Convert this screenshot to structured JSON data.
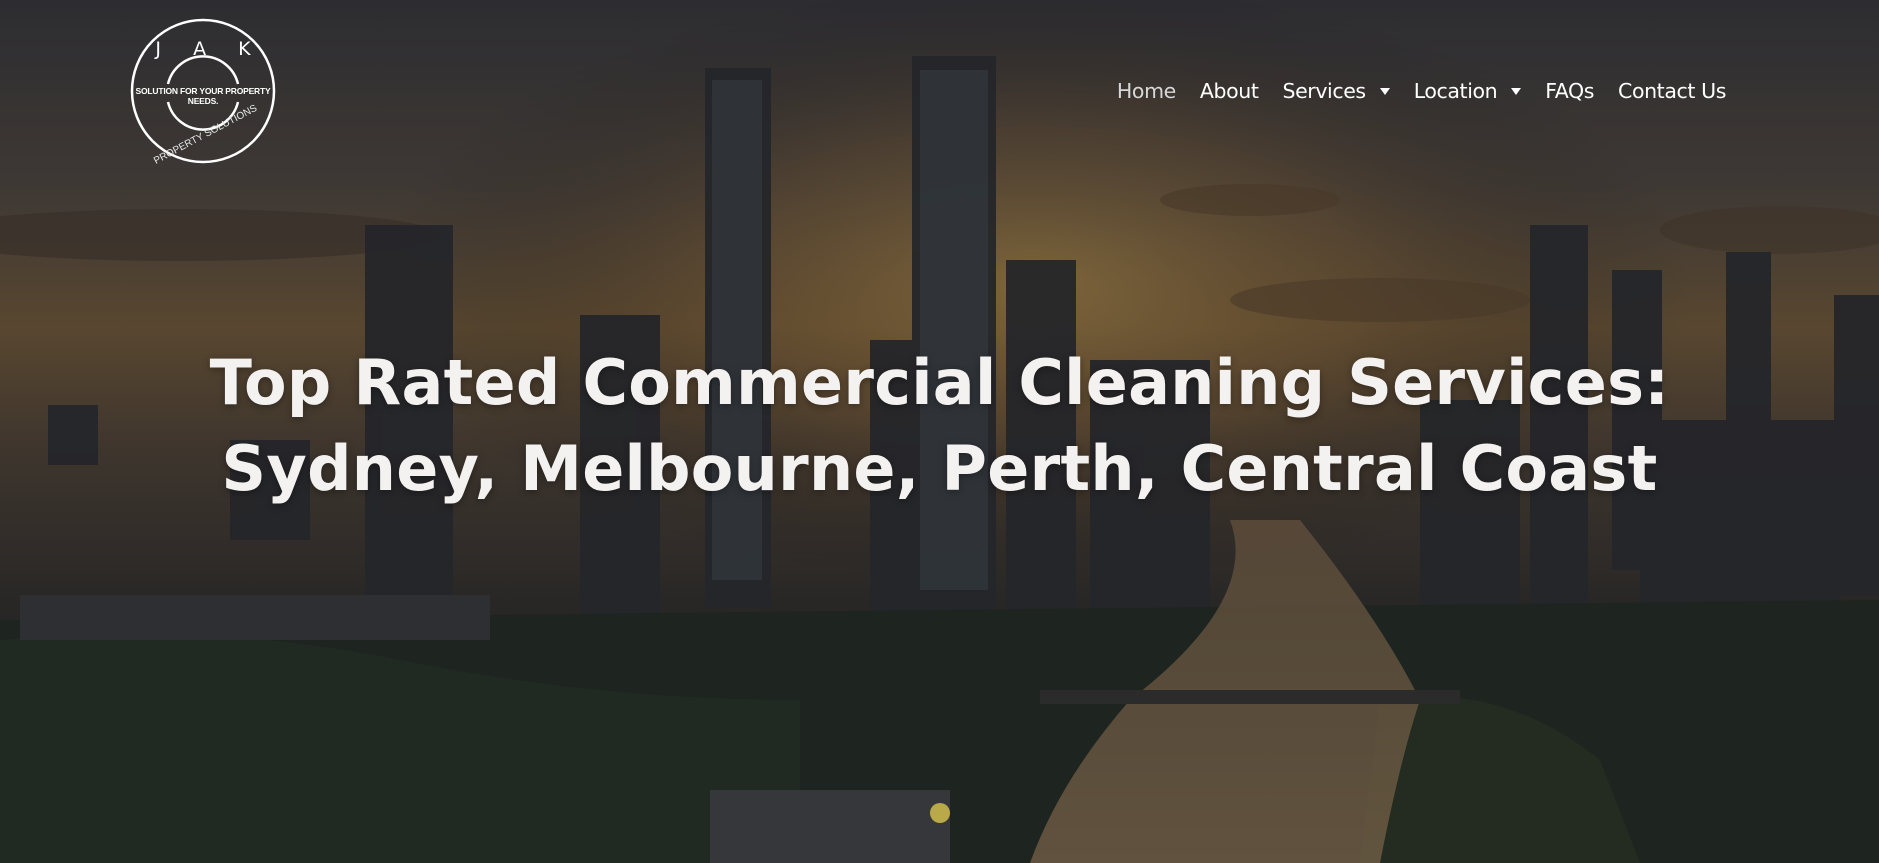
{
  "brand": {
    "letters": "J A K",
    "tagline": "SOLUTION FOR YOUR PROPERTY NEEDS.",
    "subtitle": "PROPERTY SOLUTIONS"
  },
  "nav": {
    "items": [
      {
        "label": "Home",
        "active": true
      },
      {
        "label": "About",
        "has_dropdown": false
      },
      {
        "label": "Services",
        "has_dropdown": true
      },
      {
        "label": "Location",
        "has_dropdown": true
      },
      {
        "label": "FAQs",
        "has_dropdown": false
      },
      {
        "label": "Contact Us",
        "has_dropdown": false
      }
    ]
  },
  "hero": {
    "headline_line1": "Top Rated Commercial Cleaning Services:",
    "headline_line2": "Sydney, Melbourne, Perth, Central Coast"
  },
  "colors": {
    "text": "#ffffff",
    "overlay": "#2a2a2e",
    "accent_dot": "#c9b64a"
  },
  "icons": {
    "caret": "chevron-down-icon",
    "slide_indicator": "dot-icon"
  }
}
